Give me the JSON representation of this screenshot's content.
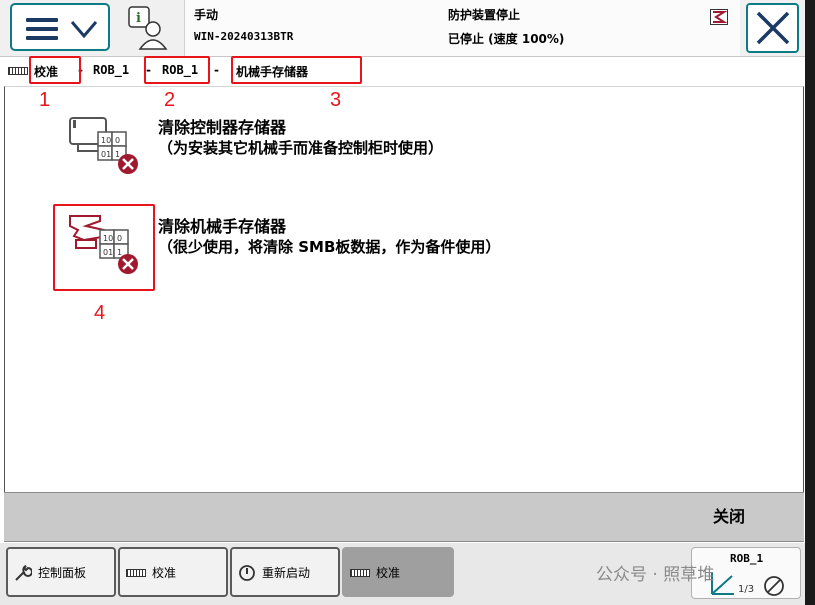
{
  "header": {
    "mode": "手动",
    "system_name": "WIN-20240313BTR",
    "safety_status": "防护装置停止",
    "run_status": "已停止 (速度 100%)"
  },
  "breadcrumb": {
    "items": [
      "校准",
      "ROB_1",
      "ROB_1",
      "机械手存储器"
    ],
    "separator": "-"
  },
  "annotations": [
    "1",
    "2",
    "3",
    "4"
  ],
  "items": [
    {
      "title": "清除控制器存储器",
      "description": "（为安装其它机械手而准备控制柜时使用）",
      "icon": "clear-controller-memory-icon"
    },
    {
      "title": "清除机械手存储器",
      "description": "（很少使用，将清除 SMB板数据，作为备件使用）",
      "icon": "clear-robot-memory-icon"
    }
  ],
  "actions": {
    "close_label": "关闭"
  },
  "taskbar": {
    "items": [
      {
        "label": "控制面板",
        "icon": "wrench-icon"
      },
      {
        "label": "校准",
        "icon": "calibration-icon"
      },
      {
        "label": "重新启动",
        "icon": "restart-icon"
      },
      {
        "label": "校准",
        "icon": "calibration-icon"
      }
    ],
    "robot_unit": "ROB_1",
    "quickset_value": "1/3"
  },
  "watermark": "公众号 · 照草堆",
  "colors": {
    "accent": "#0d7a86",
    "annotation": "#e8141c",
    "brand_red": "#a0192e",
    "nav_blue": "#1b3a64"
  }
}
